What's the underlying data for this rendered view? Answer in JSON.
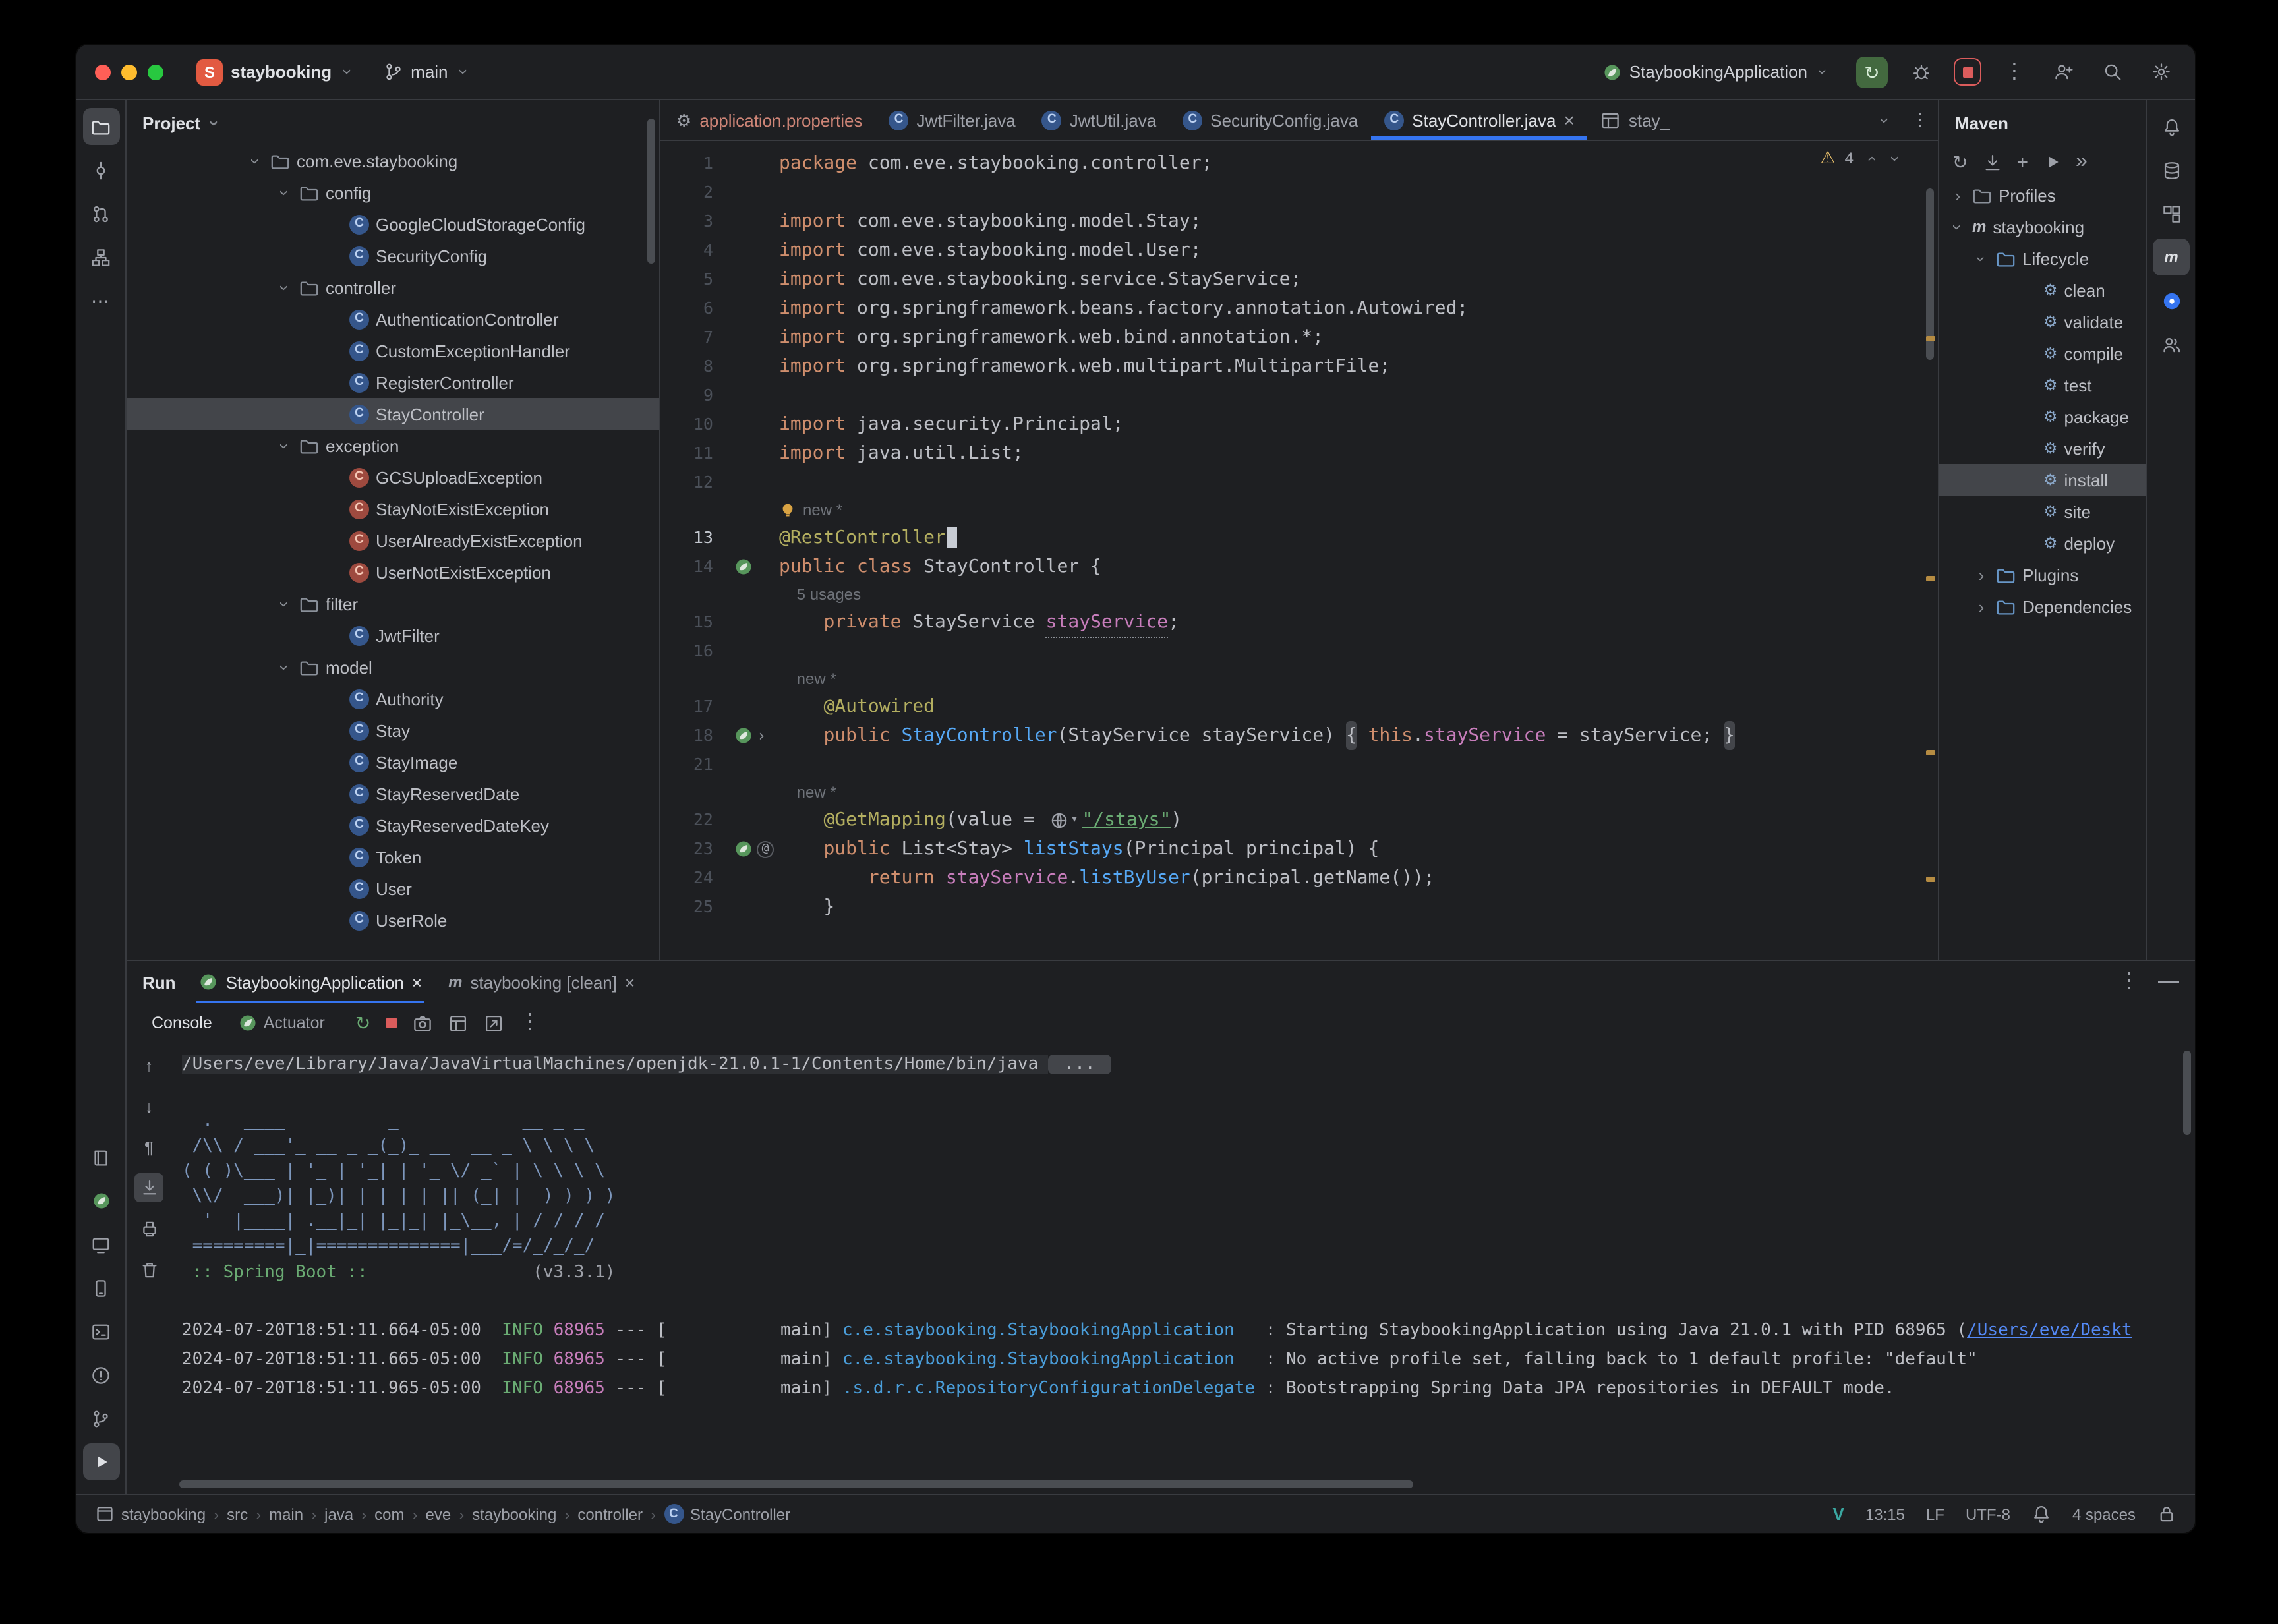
{
  "accent_color": "#3574f0",
  "titlebar": {
    "project": "staybooking",
    "branch": "main",
    "run_config": "StaybookingApplication",
    "actions": [
      {
        "name": "rerun",
        "icon": "rerun",
        "style": "green"
      },
      {
        "name": "debug",
        "icon": "bug",
        "style": ""
      },
      {
        "name": "stop",
        "icon": "stop",
        "style": "red"
      },
      {
        "name": "more",
        "icon": "kebab",
        "style": ""
      },
      {
        "name": "add-user",
        "icon": "user-plus",
        "style": ""
      },
      {
        "name": "search-everywhere",
        "icon": "search",
        "style": ""
      },
      {
        "name": "settings",
        "icon": "gear",
        "style": ""
      }
    ]
  },
  "activity_left": {
    "top": [
      {
        "name": "project",
        "icon": "folder",
        "active": true
      },
      {
        "name": "commit",
        "icon": "commit"
      },
      {
        "name": "pull-requests",
        "icon": "pull-request"
      },
      {
        "name": "structure",
        "icon": "structure"
      },
      {
        "name": "more-tools",
        "icon": "more-h"
      }
    ],
    "bottom": [
      {
        "name": "services",
        "icon": "book"
      },
      {
        "name": "spring",
        "icon": "spring"
      },
      {
        "name": "endpoints",
        "icon": "screen"
      },
      {
        "name": "profiler",
        "icon": "phone"
      },
      {
        "name": "terminal",
        "icon": "terminal"
      },
      {
        "name": "problems",
        "icon": "problems"
      },
      {
        "name": "version-control",
        "icon": "branch"
      },
      {
        "name": "run",
        "icon": "play",
        "active": true
      }
    ]
  },
  "activity_right": [
    {
      "name": "notifications",
      "icon": "bell"
    },
    {
      "name": "database",
      "icon": "database"
    },
    {
      "name": "modules",
      "icon": "modules"
    },
    {
      "name": "maven",
      "icon": "maven-m",
      "active": true
    },
    {
      "name": "assistant",
      "icon": "chat"
    },
    {
      "name": "code-with-me",
      "icon": "users"
    }
  ],
  "project_panel": {
    "title": "Project",
    "items": [
      {
        "label": "com.eve.staybooking",
        "icon": "package",
        "lvl": 1,
        "chev": "down"
      },
      {
        "label": "config",
        "icon": "package",
        "lvl": 2,
        "chev": "down"
      },
      {
        "label": "GoogleCloudStorageConfig",
        "icon": "class",
        "lvl": 3
      },
      {
        "label": "SecurityConfig",
        "icon": "class",
        "lvl": 3
      },
      {
        "label": "controller",
        "icon": "package",
        "lvl": 2,
        "chev": "down"
      },
      {
        "label": "AuthenticationController",
        "icon": "class",
        "lvl": 3
      },
      {
        "label": "CustomExceptionHandler",
        "icon": "class",
        "lvl": 3
      },
      {
        "label": "RegisterController",
        "icon": "class",
        "lvl": 3
      },
      {
        "label": "StayController",
        "icon": "class",
        "lvl": 3,
        "selected": true
      },
      {
        "label": "exception",
        "icon": "package",
        "lvl": 2,
        "chev": "down"
      },
      {
        "label": "GCSUploadException",
        "icon": "exception",
        "lvl": 3
      },
      {
        "label": "StayNotExistException",
        "icon": "exception",
        "lvl": 3
      },
      {
        "label": "UserAlreadyExistException",
        "icon": "exception",
        "lvl": 3
      },
      {
        "label": "UserNotExistException",
        "icon": "exception",
        "lvl": 3
      },
      {
        "label": "filter",
        "icon": "package",
        "lvl": 2,
        "chev": "down"
      },
      {
        "label": "JwtFilter",
        "icon": "class",
        "lvl": 3
      },
      {
        "label": "model",
        "icon": "package",
        "lvl": 2,
        "chev": "down"
      },
      {
        "label": "Authority",
        "icon": "class",
        "lvl": 3
      },
      {
        "label": "Stay",
        "icon": "class",
        "lvl": 3
      },
      {
        "label": "StayImage",
        "icon": "class",
        "lvl": 3
      },
      {
        "label": "StayReservedDate",
        "icon": "class",
        "lvl": 3
      },
      {
        "label": "StayReservedDateKey",
        "icon": "class",
        "lvl": 3
      },
      {
        "label": "Token",
        "icon": "class",
        "lvl": 3
      },
      {
        "label": "User",
        "icon": "class",
        "lvl": 3
      },
      {
        "label": "UserRole",
        "icon": "class",
        "lvl": 3
      }
    ]
  },
  "editor": {
    "warnings": "4",
    "tabs": [
      {
        "label": "application.properties",
        "icon": "properties",
        "color": "#ce8577"
      },
      {
        "label": "JwtFilter.java",
        "icon": "class"
      },
      {
        "label": "JwtUtil.java",
        "icon": "class"
      },
      {
        "label": "SecurityConfig.java",
        "icon": "class"
      },
      {
        "label": "StayController.java",
        "icon": "class",
        "active": true,
        "close": true
      },
      {
        "label": "stay_",
        "icon": "table"
      }
    ],
    "lines": [
      {
        "n": "1",
        "tk": [
          [
            "package ",
            "kw"
          ],
          [
            "com.eve.staybooking.controller;",
            "pl"
          ]
        ]
      },
      {
        "n": "2",
        "tk": []
      },
      {
        "n": "3",
        "tk": [
          [
            "import ",
            "kw"
          ],
          [
            "com.eve.staybooking.model.Stay;",
            "pl"
          ]
        ]
      },
      {
        "n": "4",
        "tk": [
          [
            "import ",
            "kw"
          ],
          [
            "com.eve.staybooking.model.User;",
            "pl"
          ]
        ]
      },
      {
        "n": "5",
        "tk": [
          [
            "import ",
            "kw"
          ],
          [
            "com.eve.staybooking.service.StayService;",
            "pl"
          ]
        ]
      },
      {
        "n": "6",
        "tk": [
          [
            "import ",
            "kw"
          ],
          [
            "org.springframework.beans.factory.annotation.Autowired;",
            "pl"
          ]
        ]
      },
      {
        "n": "7",
        "tk": [
          [
            "import ",
            "kw"
          ],
          [
            "org.springframework.web.bind.annotation.*;",
            "pl"
          ]
        ]
      },
      {
        "n": "8",
        "tk": [
          [
            "import ",
            "kw"
          ],
          [
            "org.springframework.web.multipart.MultipartFile;",
            "pl"
          ]
        ]
      },
      {
        "n": "9",
        "tk": []
      },
      {
        "n": "10",
        "tk": [
          [
            "import ",
            "kw"
          ],
          [
            "java.security.Principal;",
            "pl"
          ]
        ]
      },
      {
        "n": "11",
        "tk": [
          [
            "import ",
            "kw"
          ],
          [
            "java.util.List;",
            "pl"
          ]
        ]
      },
      {
        "n": "12",
        "tk": []
      },
      {
        "n": "",
        "inlay": true,
        "bulb": true,
        "tk": [
          [
            "new *",
            "inlay"
          ]
        ]
      },
      {
        "n": "13",
        "cur": true,
        "caret": true,
        "tk": [
          [
            "@RestController",
            "ann"
          ]
        ]
      },
      {
        "n": "14",
        "g": [
          "leaf"
        ],
        "tk": [
          [
            "public class ",
            "kw"
          ],
          [
            "StayController",
            "pl"
          ],
          [
            " {",
            "pl"
          ]
        ]
      },
      {
        "n": "",
        "inlay": true,
        "tk": [
          [
            "    5 usages",
            "inlay"
          ]
        ]
      },
      {
        "n": "15",
        "tk": [
          [
            "    ",
            "pl"
          ],
          [
            "private ",
            "kw"
          ],
          [
            "StayService ",
            "pl"
          ],
          [
            "stayService",
            "fieldu"
          ],
          [
            ";",
            "pl"
          ]
        ]
      },
      {
        "n": "16",
        "tk": []
      },
      {
        "n": "",
        "inlay": true,
        "tk": [
          [
            "    new *",
            "inlay"
          ]
        ]
      },
      {
        "n": "17",
        "tk": [
          [
            "    ",
            "pl"
          ],
          [
            "@Autowired",
            "ann"
          ]
        ]
      },
      {
        "n": "18",
        "g": [
          "leaf",
          "fold"
        ],
        "tk": [
          [
            "    ",
            "pl"
          ],
          [
            "public ",
            "kw"
          ],
          [
            "StayController",
            "mth"
          ],
          [
            "(StayService stayService) ",
            "pl"
          ],
          [
            "{",
            "foldm"
          ],
          [
            " ",
            "pl"
          ],
          [
            "this",
            "kw"
          ],
          [
            ".",
            "pl"
          ],
          [
            "stayService",
            "field"
          ],
          [
            " = stayService; ",
            "pl"
          ],
          [
            "}",
            "foldm"
          ]
        ]
      },
      {
        "n": "21",
        "tk": []
      },
      {
        "n": "",
        "inlay": true,
        "tk": [
          [
            "    new *",
            "inlay"
          ]
        ]
      },
      {
        "n": "22",
        "tk": [
          [
            "    ",
            "pl"
          ],
          [
            "@GetMapping",
            "ann"
          ],
          [
            "(value = ",
            "pl"
          ],
          [
            "",
            "icn"
          ],
          [
            "\"/stays\"",
            "strl"
          ],
          [
            ")",
            "pl"
          ]
        ]
      },
      {
        "n": "23",
        "g": [
          "leaf",
          "at"
        ],
        "tk": [
          [
            "    ",
            "pl"
          ],
          [
            "public ",
            "kw"
          ],
          [
            "List<Stay> ",
            "pl"
          ],
          [
            "listStays",
            "mth"
          ],
          [
            "(Principal principal) {",
            "pl"
          ]
        ]
      },
      {
        "n": "24",
        "tk": [
          [
            "        ",
            "pl"
          ],
          [
            "return ",
            "kw"
          ],
          [
            "stayService",
            "field"
          ],
          [
            ".",
            "pl"
          ],
          [
            "listByUser",
            "mth"
          ],
          [
            "(principal.getName());",
            "pl"
          ]
        ]
      },
      {
        "n": "25",
        "tk": [
          [
            "    }",
            "pl"
          ]
        ]
      }
    ]
  },
  "maven_panel": {
    "title": "Maven",
    "toolbar": [
      {
        "name": "reload",
        "icon": "refresh"
      },
      {
        "name": "download-sources",
        "icon": "download"
      },
      {
        "name": "add-config",
        "icon": "plus"
      },
      {
        "name": "execute-goal",
        "icon": "play"
      },
      {
        "name": "overflow",
        "icon": "chevrons"
      }
    ],
    "items": [
      {
        "label": "Profiles",
        "icon": "pkg-folder",
        "lvl": 1,
        "chev": "right"
      },
      {
        "label": "staybooking",
        "icon": "maven-m",
        "lvl": 1,
        "chev": "down"
      },
      {
        "label": "Lifecycle",
        "icon": "blue-folder",
        "lvl": 2,
        "chev": "down"
      },
      {
        "label": "clean",
        "icon": "goal",
        "lvl": 3
      },
      {
        "label": "validate",
        "icon": "goal",
        "lvl": 3
      },
      {
        "label": "compile",
        "icon": "goal",
        "lvl": 3
      },
      {
        "label": "test",
        "icon": "goal",
        "lvl": 3
      },
      {
        "label": "package",
        "icon": "goal",
        "lvl": 3
      },
      {
        "label": "verify",
        "icon": "goal",
        "lvl": 3
      },
      {
        "label": "install",
        "icon": "goal",
        "lvl": 3,
        "selected": true
      },
      {
        "label": "site",
        "icon": "goal",
        "lvl": 3
      },
      {
        "label": "deploy",
        "icon": "goal",
        "lvl": 3
      },
      {
        "label": "Plugins",
        "icon": "blue-folder",
        "lvl": 2,
        "chev": "right"
      },
      {
        "label": "Dependencies",
        "icon": "blue-folder",
        "lvl": 2,
        "chev": "right"
      }
    ]
  },
  "run_panel": {
    "title": "Run",
    "tabs": [
      {
        "label": "StaybookingApplication",
        "icon": "spring",
        "active": true
      },
      {
        "label": "staybooking [clean]",
        "icon": "maven-m"
      }
    ],
    "head_actions": [
      {
        "name": "more",
        "icon": "kebab"
      },
      {
        "name": "hide",
        "icon": "minimize"
      }
    ],
    "view_tabs": [
      {
        "label": "Console",
        "active": true
      },
      {
        "label": "Actuator",
        "icon": "spring"
      }
    ],
    "toolbar": [
      {
        "name": "rerun",
        "icon": "rerun",
        "cls": "rt-green"
      },
      {
        "name": "stop",
        "icon": "stop-sq",
        "cls": "rt-red"
      },
      {
        "name": "screenshot",
        "icon": "camera",
        "cls": ""
      },
      {
        "name": "restore-layout",
        "icon": "layout",
        "cls": ""
      },
      {
        "name": "export",
        "icon": "export",
        "cls": ""
      },
      {
        "name": "more",
        "icon": "kebab",
        "cls": ""
      }
    ],
    "strip": [
      {
        "name": "prev-occurrence",
        "icon": "arrow-up"
      },
      {
        "name": "next-occurrence",
        "icon": "arrow-down"
      },
      {
        "name": "soft-wrap",
        "icon": "wrap"
      },
      {
        "name": "scroll-to-end",
        "icon": "scroll-end",
        "active": true
      },
      {
        "name": "print",
        "icon": "print"
      },
      {
        "name": "clear-all",
        "icon": "trash"
      }
    ],
    "console": [
      {
        "tk": [
          [
            "/Users/eve/Library/Java/JavaVirtualMachines/openjdk-21.0.1-1/Contents/Home/bin/java ",
            "path"
          ],
          [
            " ... ",
            "pill"
          ]
        ]
      },
      {
        "tk": []
      },
      {
        "cls": "r-banner",
        "tk": [
          [
            "  .   ____          _            __ _ _",
            "banner"
          ]
        ]
      },
      {
        "cls": "r-banner",
        "tk": [
          [
            " /\\\\ / ___'_ __ _ _(_)_ __  __ _ \\ \\ \\ \\",
            "banner"
          ]
        ]
      },
      {
        "cls": "r-banner",
        "tk": [
          [
            "( ( )\\___ | '_ | '_| | '_ \\/ _` | \\ \\ \\ \\",
            "banner"
          ]
        ]
      },
      {
        "cls": "r-banner",
        "tk": [
          [
            " \\\\/  ___)| |_)| | | | | || (_| |  ) ) ) )",
            "banner"
          ]
        ]
      },
      {
        "cls": "r-banner",
        "tk": [
          [
            "  '  |____| .__|_| |_|_| |_\\__, | / / / /",
            "banner"
          ]
        ]
      },
      {
        "cls": "r-banner",
        "tk": [
          [
            " =========|_|==============|___/=/_/_/_/",
            "banner"
          ]
        ]
      },
      {
        "tk": [
          [
            " :: Spring Boot ::",
            "green"
          ],
          [
            "                (v3.3.1)",
            "dim"
          ]
        ]
      },
      {
        "tk": []
      },
      {
        "tk": [
          [
            "2024-07-20T18:51:11.664-05:00",
            "pl"
          ],
          [
            "  ",
            "pl"
          ],
          [
            "INFO",
            "info"
          ],
          [
            " ",
            "pl"
          ],
          [
            "68965",
            "pid"
          ],
          [
            " --- [",
            "pl"
          ],
          [
            "           main",
            "pl"
          ],
          [
            "] ",
            "pl"
          ],
          [
            "c.e.staybooking.StaybookingApplication  ",
            "logger"
          ],
          [
            " : Starting StaybookingApplication using Java 21.0.1 with PID 68965 (",
            "pl"
          ],
          [
            "/Users/eve/Deskt",
            "link"
          ]
        ]
      },
      {
        "tk": [
          [
            "2024-07-20T18:51:11.665-05:00",
            "pl"
          ],
          [
            "  ",
            "pl"
          ],
          [
            "INFO",
            "info"
          ],
          [
            " ",
            "pl"
          ],
          [
            "68965",
            "pid"
          ],
          [
            " --- [",
            "pl"
          ],
          [
            "           main",
            "pl"
          ],
          [
            "] ",
            "pl"
          ],
          [
            "c.e.staybooking.StaybookingApplication  ",
            "logger"
          ],
          [
            " : No active profile set, falling back to 1 default profile: \"default\"",
            "pl"
          ]
        ]
      },
      {
        "tk": [
          [
            "2024-07-20T18:51:11.965-05:00",
            "pl"
          ],
          [
            "  ",
            "pl"
          ],
          [
            "INFO",
            "info"
          ],
          [
            " ",
            "pl"
          ],
          [
            "68965",
            "pid"
          ],
          [
            " --- [",
            "pl"
          ],
          [
            "           main",
            "pl"
          ],
          [
            "] ",
            "pl"
          ],
          [
            ".s.d.r.c.RepositoryConfigurationDelegate",
            "logger"
          ],
          [
            " : Bootstrapping Spring Data JPA repositories in DEFAULT mode.",
            "pl"
          ]
        ]
      }
    ]
  },
  "statusbar": {
    "breadcrumbs": [
      "staybooking",
      "src",
      "main",
      "java",
      "com",
      "eve",
      "staybooking",
      "controller",
      "StayController"
    ],
    "vim": "V",
    "position": "13:15",
    "line_separator": "LF",
    "encoding": "UTF-8",
    "indent": "4 spaces"
  }
}
